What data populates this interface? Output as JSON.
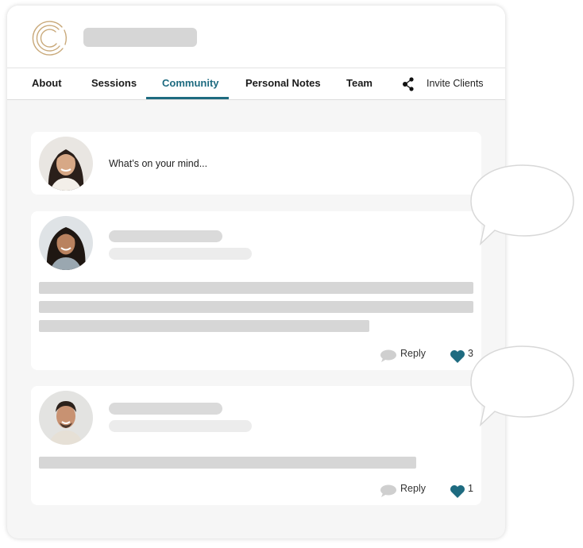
{
  "header": {
    "title": ""
  },
  "nav": {
    "tabs": [
      {
        "label": "About"
      },
      {
        "label": "Sessions"
      },
      {
        "label": "Community",
        "active": true
      },
      {
        "label": "Personal Notes"
      },
      {
        "label": "Team"
      }
    ],
    "invite": {
      "label": "Invite Clients",
      "icon": "share-icon"
    }
  },
  "composer": {
    "placeholder": "What’s on your mind..."
  },
  "posts": [
    {
      "reply_label": "Reply",
      "likes": "3"
    },
    {
      "reply_label": "Reply",
      "likes": "1"
    }
  ],
  "colors": {
    "accent": "#1e6b80",
    "logo": "#c9a97a",
    "placeholder": "#d6d6d6"
  }
}
